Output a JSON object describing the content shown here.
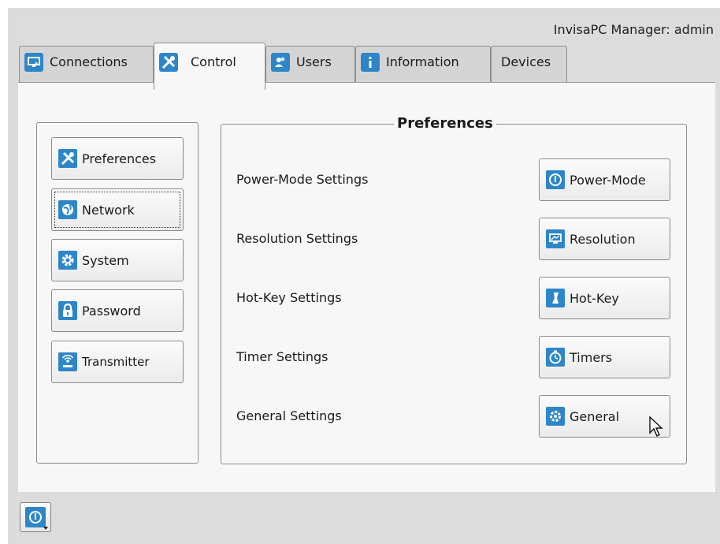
{
  "app_title": "InvisaPC Manager: admin",
  "tabs": [
    {
      "label": "Connections",
      "icon": "monitor-icon",
      "active": false
    },
    {
      "label": "Control",
      "icon": "tools-icon",
      "active": true
    },
    {
      "label": "Users",
      "icon": "users-icon",
      "active": false
    },
    {
      "label": "Information",
      "icon": "info-icon",
      "active": false
    },
    {
      "label": "Devices",
      "icon": "",
      "active": false
    }
  ],
  "sidebar": {
    "items": [
      {
        "label": "Preferences",
        "icon": "tools-icon",
        "selected": true
      },
      {
        "label": "Network",
        "icon": "network-icon",
        "focused": true
      },
      {
        "label": "System",
        "icon": "gear-icon"
      },
      {
        "label": "Password",
        "icon": "lock-icon"
      },
      {
        "label": "Transmitter",
        "icon": "transmitter-icon"
      }
    ]
  },
  "preferences": {
    "title": "Preferences",
    "rows": [
      {
        "label": "Power-Mode Settings",
        "button": "Power-Mode",
        "icon": "power-icon"
      },
      {
        "label": "Resolution Settings",
        "button": "Resolution",
        "icon": "display-icon"
      },
      {
        "label": "Hot-Key Settings",
        "button": "Hot-Key",
        "icon": "hotkey-icon"
      },
      {
        "label": "Timer Settings",
        "button": "Timers",
        "icon": "stopwatch-icon"
      },
      {
        "label": "General Settings",
        "button": "General",
        "icon": "gear-icon"
      }
    ]
  },
  "footer": {
    "power_menu_icon": "power-icon"
  },
  "colors": {
    "accent": "#2e86c8",
    "panel_bg": "#f7f7f7",
    "frame_bg": "#dcdcdc"
  }
}
